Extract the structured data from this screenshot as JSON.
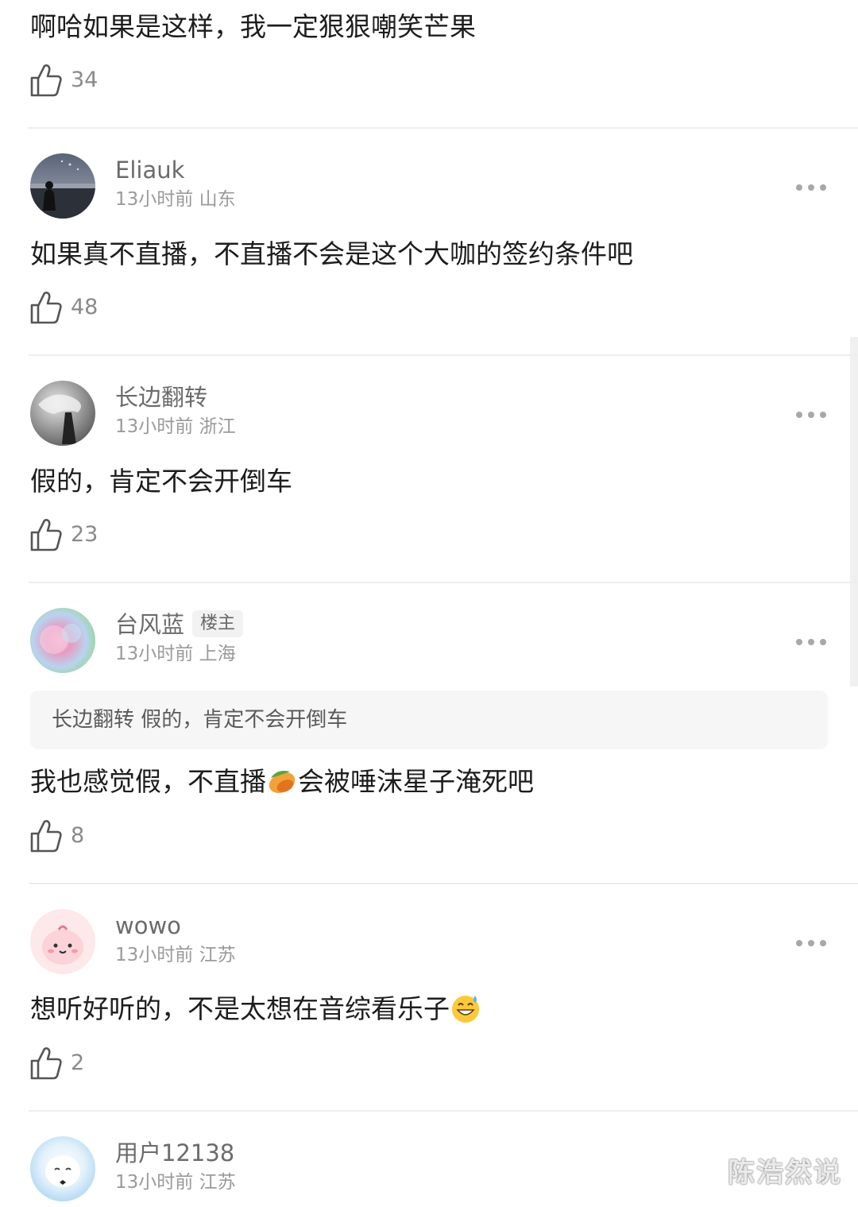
{
  "top_comment": {
    "text": "啊哈如果是这样，我一定狠狠嘲笑芒果",
    "likes": "34"
  },
  "comments": [
    {
      "username": "Eliauk",
      "time": "13小时前",
      "location": "山东",
      "avatar": "avatar-photo-seaside",
      "text": "如果真不直播，不直播不会是这个大咖的签约条件吧",
      "likes": "48"
    },
    {
      "username": "长边翻转",
      "time": "13小时前",
      "location": "浙江",
      "avatar": "avatar-photo-bw-smoke",
      "text": "假的，肯定不会开倒车",
      "likes": "23"
    },
    {
      "username": "台风蓝",
      "badge": "楼主",
      "time": "13小时前",
      "location": "上海",
      "avatar": "avatar-pastel-gradient",
      "quote": {
        "user": "长边翻转",
        "text": "假的，肯定不会开倒车"
      },
      "text_before": "我也感觉假，不直播",
      "emoji": "mango-icon",
      "text_after": "会被唾沫星子淹死吧",
      "likes": "8"
    },
    {
      "username": "wowo",
      "time": "13小时前",
      "location": "江苏",
      "avatar": "avatar-pink-cartoon",
      "text": "想听好听的，不是太想在音综看乐子",
      "emoji": "grinning-sweat-emoji",
      "likes": "2"
    },
    {
      "username": "用户12138",
      "time": "13小时前",
      "location": "江苏",
      "avatar": "avatar-white-cartoon"
    }
  ],
  "watermark": "陈浩然说",
  "colors": {
    "text": "#1d1d1d",
    "username": "#6b6b6b",
    "meta": "#9a9a9a",
    "divider": "#eeeeee",
    "quote_bg": "#f6f6f6"
  }
}
